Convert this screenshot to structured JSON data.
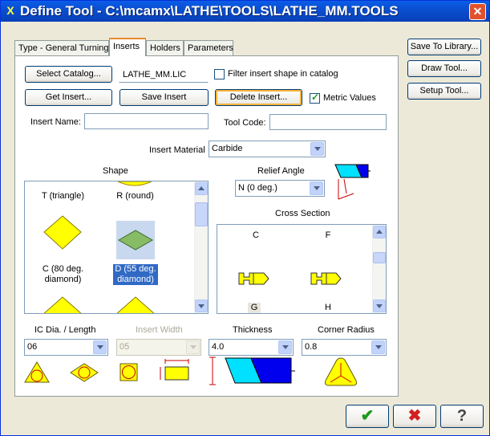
{
  "window": {
    "title": "Define Tool - C:\\mcamx\\LATHE\\TOOLS\\LATHE_MM.TOOLS",
    "close_glyph": "✕"
  },
  "tabs": [
    {
      "label": "Type - General Turning"
    },
    {
      "label": "Inserts"
    },
    {
      "label": "Holders"
    },
    {
      "label": "Parameters"
    }
  ],
  "side_buttons": {
    "save_to_library": "Save To Library...",
    "draw_tool": "Draw Tool...",
    "setup_tool": "Setup Tool..."
  },
  "inserts": {
    "select_catalog": "Select Catalog...",
    "catalog_name": "LATHE_MM.LIC",
    "filter_label": "Filter insert shape in catalog",
    "filter_checked": false,
    "get_insert": "Get Insert...",
    "save_insert": "Save Insert",
    "delete_insert": "Delete Insert...",
    "metric_label": "Metric Values",
    "metric_checked": true,
    "insert_name_label": "Insert Name:",
    "insert_name_value": "",
    "tool_code_label": "Tool Code:",
    "tool_code_value": "",
    "material_label": "Insert Material",
    "material_value": "Carbide",
    "shape_label": "Shape",
    "shapes": [
      {
        "label": "T (triangle)"
      },
      {
        "label": "R (round)"
      },
      {
        "label": "C (80 deg. diamond)"
      },
      {
        "label": "D (55 deg. diamond)",
        "selected": true
      }
    ],
    "relief_label": "Relief Angle",
    "relief_value": "N (0 deg.)",
    "cross_section_label": "Cross Section",
    "cross_sections": [
      {
        "label": "C"
      },
      {
        "label": "F"
      },
      {
        "label": "G"
      },
      {
        "label": "H"
      }
    ],
    "ic_label": "IC Dia. / Length",
    "ic_value": "06",
    "width_label": "Insert Width",
    "width_value": "05",
    "thickness_label": "Thickness",
    "thickness_value": "4.0",
    "corner_label": "Corner Radius",
    "corner_value": "0.8"
  },
  "footer": {
    "ok_glyph": "✔",
    "cancel_glyph": "✖",
    "help_glyph": "?"
  },
  "colors": {
    "title_bar": "#0a4fd0",
    "insert_fill": "#ffff00",
    "selection": "#316ac5",
    "ok_green": "#1a9a1a",
    "cancel_red": "#d42020"
  }
}
